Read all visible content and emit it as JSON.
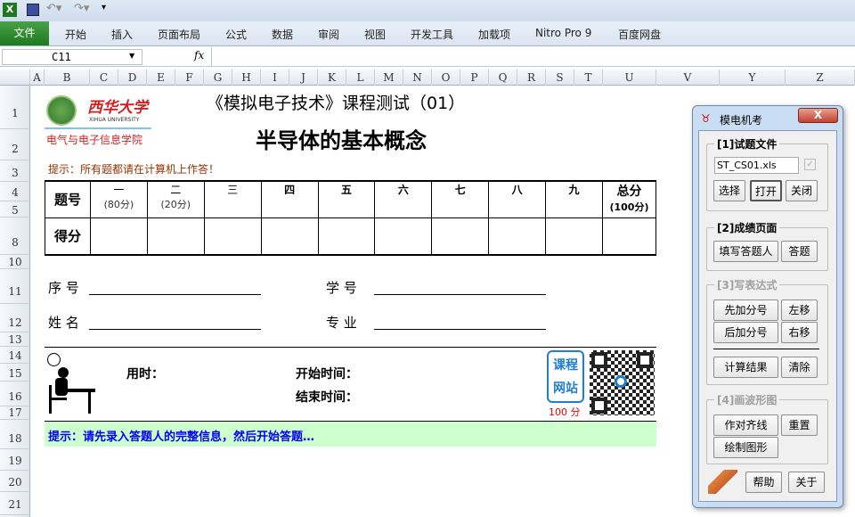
{
  "excel": {
    "ribbon_tabs": [
      "文件",
      "开始",
      "插入",
      "页面布局",
      "公式",
      "数据",
      "审阅",
      "视图",
      "开发工具",
      "加载项",
      "Nitro Pro 9",
      "百度网盘"
    ],
    "name_box": "C11",
    "fx": "fx",
    "columns": [
      "A",
      "B",
      "C",
      "D",
      "E",
      "F",
      "G",
      "H",
      "I",
      "J",
      "K",
      "L",
      "M",
      "N",
      "O",
      "P",
      "Q",
      "R",
      "S",
      "T",
      "U",
      "V",
      "Y",
      "Z"
    ],
    "rows": [
      "1",
      "2",
      "3",
      "4",
      "5",
      "8",
      "10",
      "11",
      "12",
      "13",
      "14",
      "15",
      "16",
      "17",
      "18",
      "19",
      "20",
      "21"
    ]
  },
  "sheet": {
    "university": "西华大学",
    "university_en": "XIHUA UNIVERSITY",
    "college": "电气与电子信息学院",
    "course_title": "《模拟电子技术》课程测试（01）",
    "topic": "半导体的基本概念",
    "hint_top": "提示：所有题都请在计算机上作答！",
    "table": {
      "row1_label": "题号",
      "row2_label": "得分",
      "headers": [
        {
          "t": "一",
          "s": "(80分)"
        },
        {
          "t": "二",
          "s": "(20分)"
        },
        {
          "t": "三",
          "s": ""
        },
        {
          "t": "四",
          "s": ""
        },
        {
          "t": "五",
          "s": ""
        },
        {
          "t": "六",
          "s": ""
        },
        {
          "t": "七",
          "s": ""
        },
        {
          "t": "八",
          "s": ""
        },
        {
          "t": "九",
          "s": ""
        },
        {
          "t": "总分",
          "s": "(100分)"
        }
      ]
    },
    "seq_label": "序 号",
    "id_label": "学 号",
    "name_label": "姓 名",
    "major_label": "专 业",
    "time_used": "用时：",
    "start_time": "开始时间：",
    "end_time": "结束时间：",
    "site_badge": "课程网站",
    "score_badge": "100 分",
    "hint_bottom": "提示：请先录入答题人的完整信息，然后开始答题…"
  },
  "panel": {
    "title": "模电机考",
    "close": "X",
    "g1": "[1]试题文件",
    "file": "ST_CS01.xls",
    "select": "选择",
    "open": "打开",
    "close_file": "关闭",
    "g2": "[2]成绩页面",
    "fill": "填写答题人",
    "answer": "答题",
    "g3": "[3]写表达式",
    "pre": "先加分号",
    "left": "左移",
    "post": "后加分号",
    "right": "右移",
    "calc": "计算结果",
    "clear": "清除",
    "g4": "[4]画波形图",
    "align": "作对齐线",
    "reset": "重置",
    "draw": "绘制图形",
    "help": "帮助",
    "about": "关于"
  }
}
